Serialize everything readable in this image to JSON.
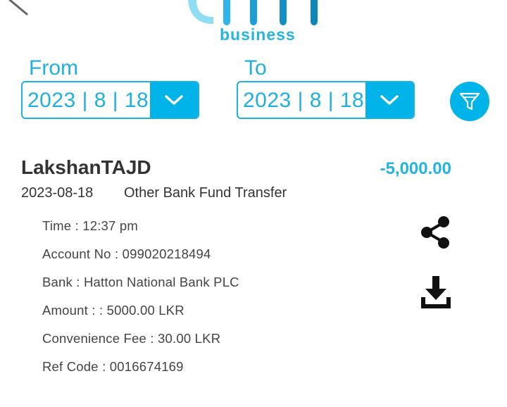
{
  "header": {
    "logo_text": "business"
  },
  "filters": {
    "from_label": "From",
    "from_value": "2023 | 8 | 18",
    "to_label": "To",
    "to_value": "2023 | 8 | 18"
  },
  "transaction": {
    "name": "LakshanTAJD",
    "amount": "-5,000.00",
    "date": "2023-08-18",
    "type": "Other Bank Fund Transfer",
    "details": {
      "time": "Time  : 12:37 pm",
      "account": "Account No  : 099020218494",
      "bank": "Bank  : Hatton National Bank PLC",
      "amount": "Amount : : 5000.00 LKR",
      "fee": "Convenience Fee : 30.00 LKR",
      "ref": "Ref Code : 0016674169"
    }
  },
  "colors": {
    "accent": "#00b3e8",
    "text": "#333333"
  },
  "icons": {
    "back": "back-arrow-icon",
    "dropdown": "chevron-down-icon",
    "filter": "filter-icon",
    "share": "share-icon",
    "download": "download-icon"
  }
}
